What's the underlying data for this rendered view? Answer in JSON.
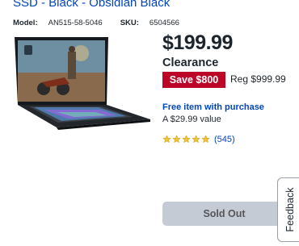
{
  "product": {
    "title_fragment": "SSD - Black - Obsidian Black",
    "model_label": "Model:",
    "model_value": "AN515-58-5046",
    "sku_label": "SKU:",
    "sku_value": "6504566"
  },
  "pricing": {
    "price": "$199.99",
    "clearance_label": "Clearance",
    "save_label": "Save $800",
    "regular_price": "Reg $999.99"
  },
  "offer": {
    "free_item_text": "Free item with purchase",
    "value_text": "A $29.99 value"
  },
  "rating": {
    "stars": 5,
    "review_count": "(545)",
    "star_color": "#f1c232"
  },
  "actions": {
    "sold_out_label": "Sold Out",
    "feedback_label": "Feedback"
  },
  "colors": {
    "link_blue": "#0046be",
    "save_red": "#bb0628",
    "sold_out_gray": "#c5cbd5"
  }
}
